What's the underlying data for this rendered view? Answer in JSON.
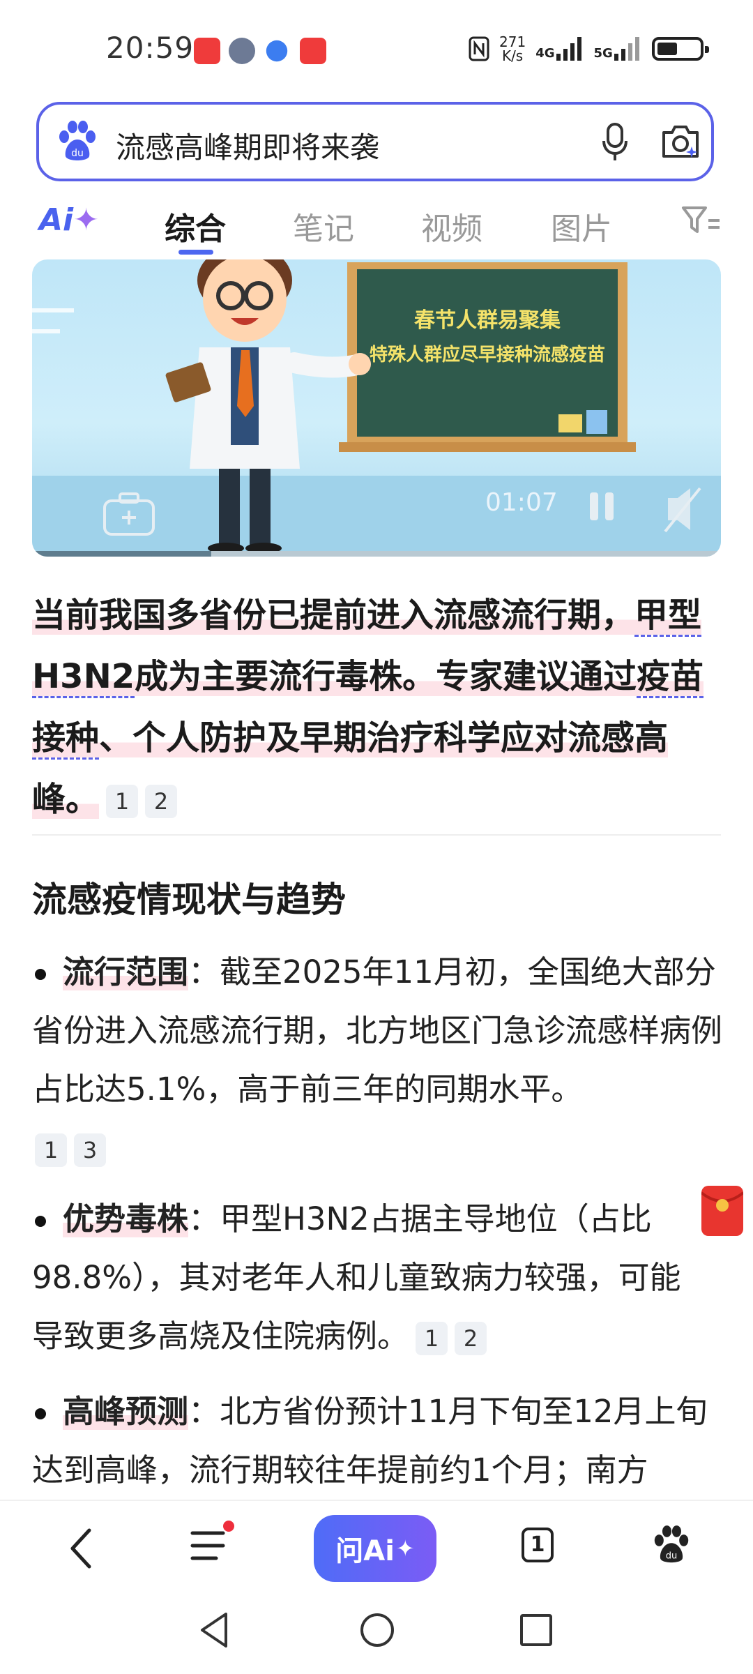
{
  "status_bar": {
    "time": "20:59",
    "net_speed_top": "271",
    "net_speed_bottom": "K/s",
    "sim1": "4G",
    "sim2": "5G"
  },
  "search": {
    "query": "流感高峰期即将来袭",
    "icons": [
      "baidu-paw-icon",
      "microphone-icon",
      "camera-search-icon"
    ]
  },
  "tabs": {
    "ai_label": "Ai",
    "items": [
      "综合",
      "笔记",
      "视频",
      "图片"
    ],
    "active": "综合"
  },
  "video": {
    "board_line1": "春节人群易聚集",
    "board_line2": "特殊人群应尽早接种流感疫苗",
    "timestamp": "01:07",
    "progress": 0.26
  },
  "summary": {
    "part1": "当前我国多省份已提前进入流感流行期，",
    "link1": "甲型H3N2",
    "part2": "成为主要流行毒株。专家建议通过",
    "link2": "疫苗接种",
    "part3": "、个人防护及早期治疗科学应对流感高峰。",
    "citations": [
      "1",
      "2"
    ]
  },
  "section": {
    "heading": "流感疫情现状与趋势",
    "bullets": [
      {
        "key": "流行范围",
        "text": "：截至2025年11月初，全国绝大部分省份进入流感流行期，北方地区门急诊流感样病例占比达5.1%，高于前三年的同期水平。",
        "citations": [
          "1",
          "3"
        ]
      },
      {
        "key": "优势毒株",
        "text": "：甲型H3N2占据主导地位（占比98.8%），其对老年人和儿童致病力较强，可能导致更多高烧及住院病例。",
        "citations": [
          "1",
          "2"
        ]
      },
      {
        "key": "高峰预测",
        "text": "：北方省份预计11月下旬至12月上旬达到高峰，流行期较往年提前约1个月；南方",
        "citations": []
      }
    ]
  },
  "bottom_nav": {
    "ask_ai_label": "问Ai",
    "tab_count": "1"
  },
  "colors": {
    "accent": "#5b62e8",
    "highlight": "#fde3e8",
    "ask_ai_start": "#4f6cf7",
    "ask_ai_end": "#7b5cf5"
  }
}
